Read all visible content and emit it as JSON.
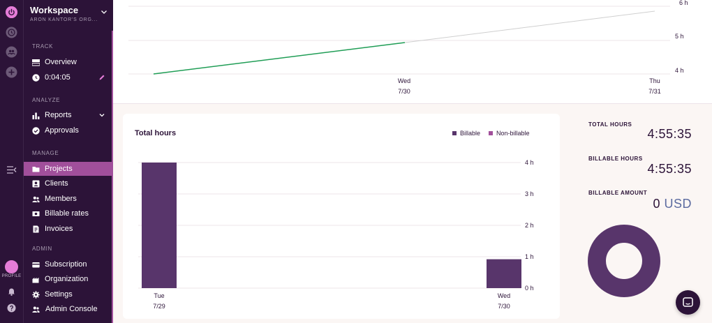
{
  "sidebar": {
    "workspace_title": "Workspace",
    "workspace_org": "ARON KANTOR'S ORG...",
    "sections": {
      "track": "TRACK",
      "analyze": "ANALYZE",
      "manage": "MANAGE",
      "admin": "ADMIN"
    },
    "items": {
      "overview": "Overview",
      "timer": "0:04:05",
      "reports": "Reports",
      "approvals": "Approvals",
      "projects": "Projects",
      "clients": "Clients",
      "members": "Members",
      "billable_rates": "Billable rates",
      "invoices": "Invoices",
      "subscription": "Subscription",
      "organization": "Organization",
      "settings": "Settings",
      "admin_console": "Admin Console"
    },
    "active_item": "Projects"
  },
  "rail": {
    "profile_label": "PROFILE",
    "icons": [
      "power-icon",
      "clock-icon",
      "people-icon",
      "plus-icon",
      "collapse-sidebar-icon",
      "avatar",
      "bell-icon",
      "help-icon"
    ]
  },
  "top_chart": {
    "y_ticks": [
      "6 h",
      "5 h",
      "4 h"
    ],
    "x_days": [
      {
        "day": "Wed",
        "date": "7/30"
      },
      {
        "day": "Thu",
        "date": "7/31"
      }
    ]
  },
  "total_hours_card": {
    "title": "Total hours",
    "legend": [
      {
        "label": "Billable",
        "color": "#58356b"
      },
      {
        "label": "Non-billable",
        "color": "#a14f9b"
      }
    ]
  },
  "chart_data": {
    "type": "bar",
    "title": "Total hours",
    "categories": [
      "Tue 7/29",
      "Wed 7/30"
    ],
    "x_labels": [
      {
        "day": "Tue",
        "date": "7/29"
      },
      {
        "day": "Wed",
        "date": "7/30"
      }
    ],
    "series": [
      {
        "name": "Billable",
        "values": [
          4.0,
          0.92
        ],
        "color": "#58356b"
      }
    ],
    "y_ticks": [
      "4 h",
      "3 h",
      "2 h",
      "1 h",
      "0 h"
    ],
    "ylim": [
      0,
      4
    ],
    "grid": true,
    "legend_position": "top-right"
  },
  "stats": {
    "total_hours_label": "TOTAL HOURS",
    "total_hours_value": "4:55:35",
    "billable_hours_label": "BILLABLE HOURS",
    "billable_hours_value": "4:55:35",
    "billable_amount_label": "BILLABLE AMOUNT",
    "billable_amount_value": "0",
    "billable_amount_unit": "USD"
  },
  "colors": {
    "sidebar_bg": "#2c1338",
    "accent": "#a14f9b",
    "bar": "#58356b",
    "line": "#1f9d55"
  }
}
